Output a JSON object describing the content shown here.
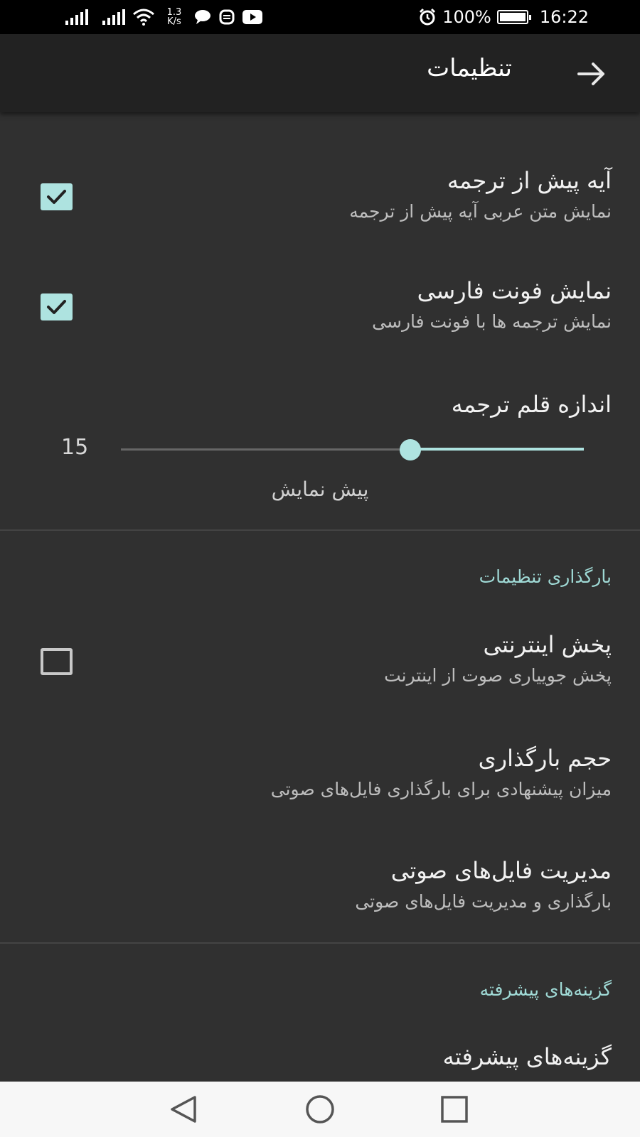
{
  "status_bar": {
    "network_speed_value": "1.3",
    "network_speed_unit": "K/s",
    "battery": "100%",
    "time": "16:22"
  },
  "toolbar": {
    "title": "تنظیمات",
    "back_icon": "arrow-right-icon"
  },
  "settings": {
    "verse_before_translation": {
      "title": "آیه پیش از ترجمه",
      "summary": "نمایش متن عربی آیه پیش از ترجمه",
      "checked": true
    },
    "persian_font": {
      "title": "نمایش فونت فارسی",
      "summary": "نمایش ترجمه ها با فونت فارسی",
      "checked": true
    },
    "translation_font_size": {
      "title": "اندازه قلم ترجمه",
      "value": "15",
      "preview_label": "پیش نمایش"
    },
    "download_category": {
      "header": "بارگذاری تنظیمات",
      "online_playback": {
        "title": "پخش اینترنتی",
        "summary": "پخش جوییاری صوت از اینترنت",
        "checked": false
      },
      "download_size": {
        "title": "حجم بارگذاری",
        "summary": "میزان پیشنهادی برای بارگذاری فایل‌های صوتی"
      },
      "audio_management": {
        "title": "مدیریت فایل‌های صوتی",
        "summary": "بارگذاری و مدیریت فایل‌های صوتی"
      }
    },
    "advanced_category": {
      "header": "گزینه‌های پیشرفته",
      "advanced_options": {
        "title": "گزینه‌های پیشرفته"
      }
    }
  },
  "colors": {
    "accent": "#aee3e0",
    "background": "#303030",
    "toolbar": "#222222"
  },
  "nav_bar": {
    "back_icon": "triangle-back-icon",
    "home_icon": "circle-home-icon",
    "recents_icon": "square-recents-icon"
  }
}
